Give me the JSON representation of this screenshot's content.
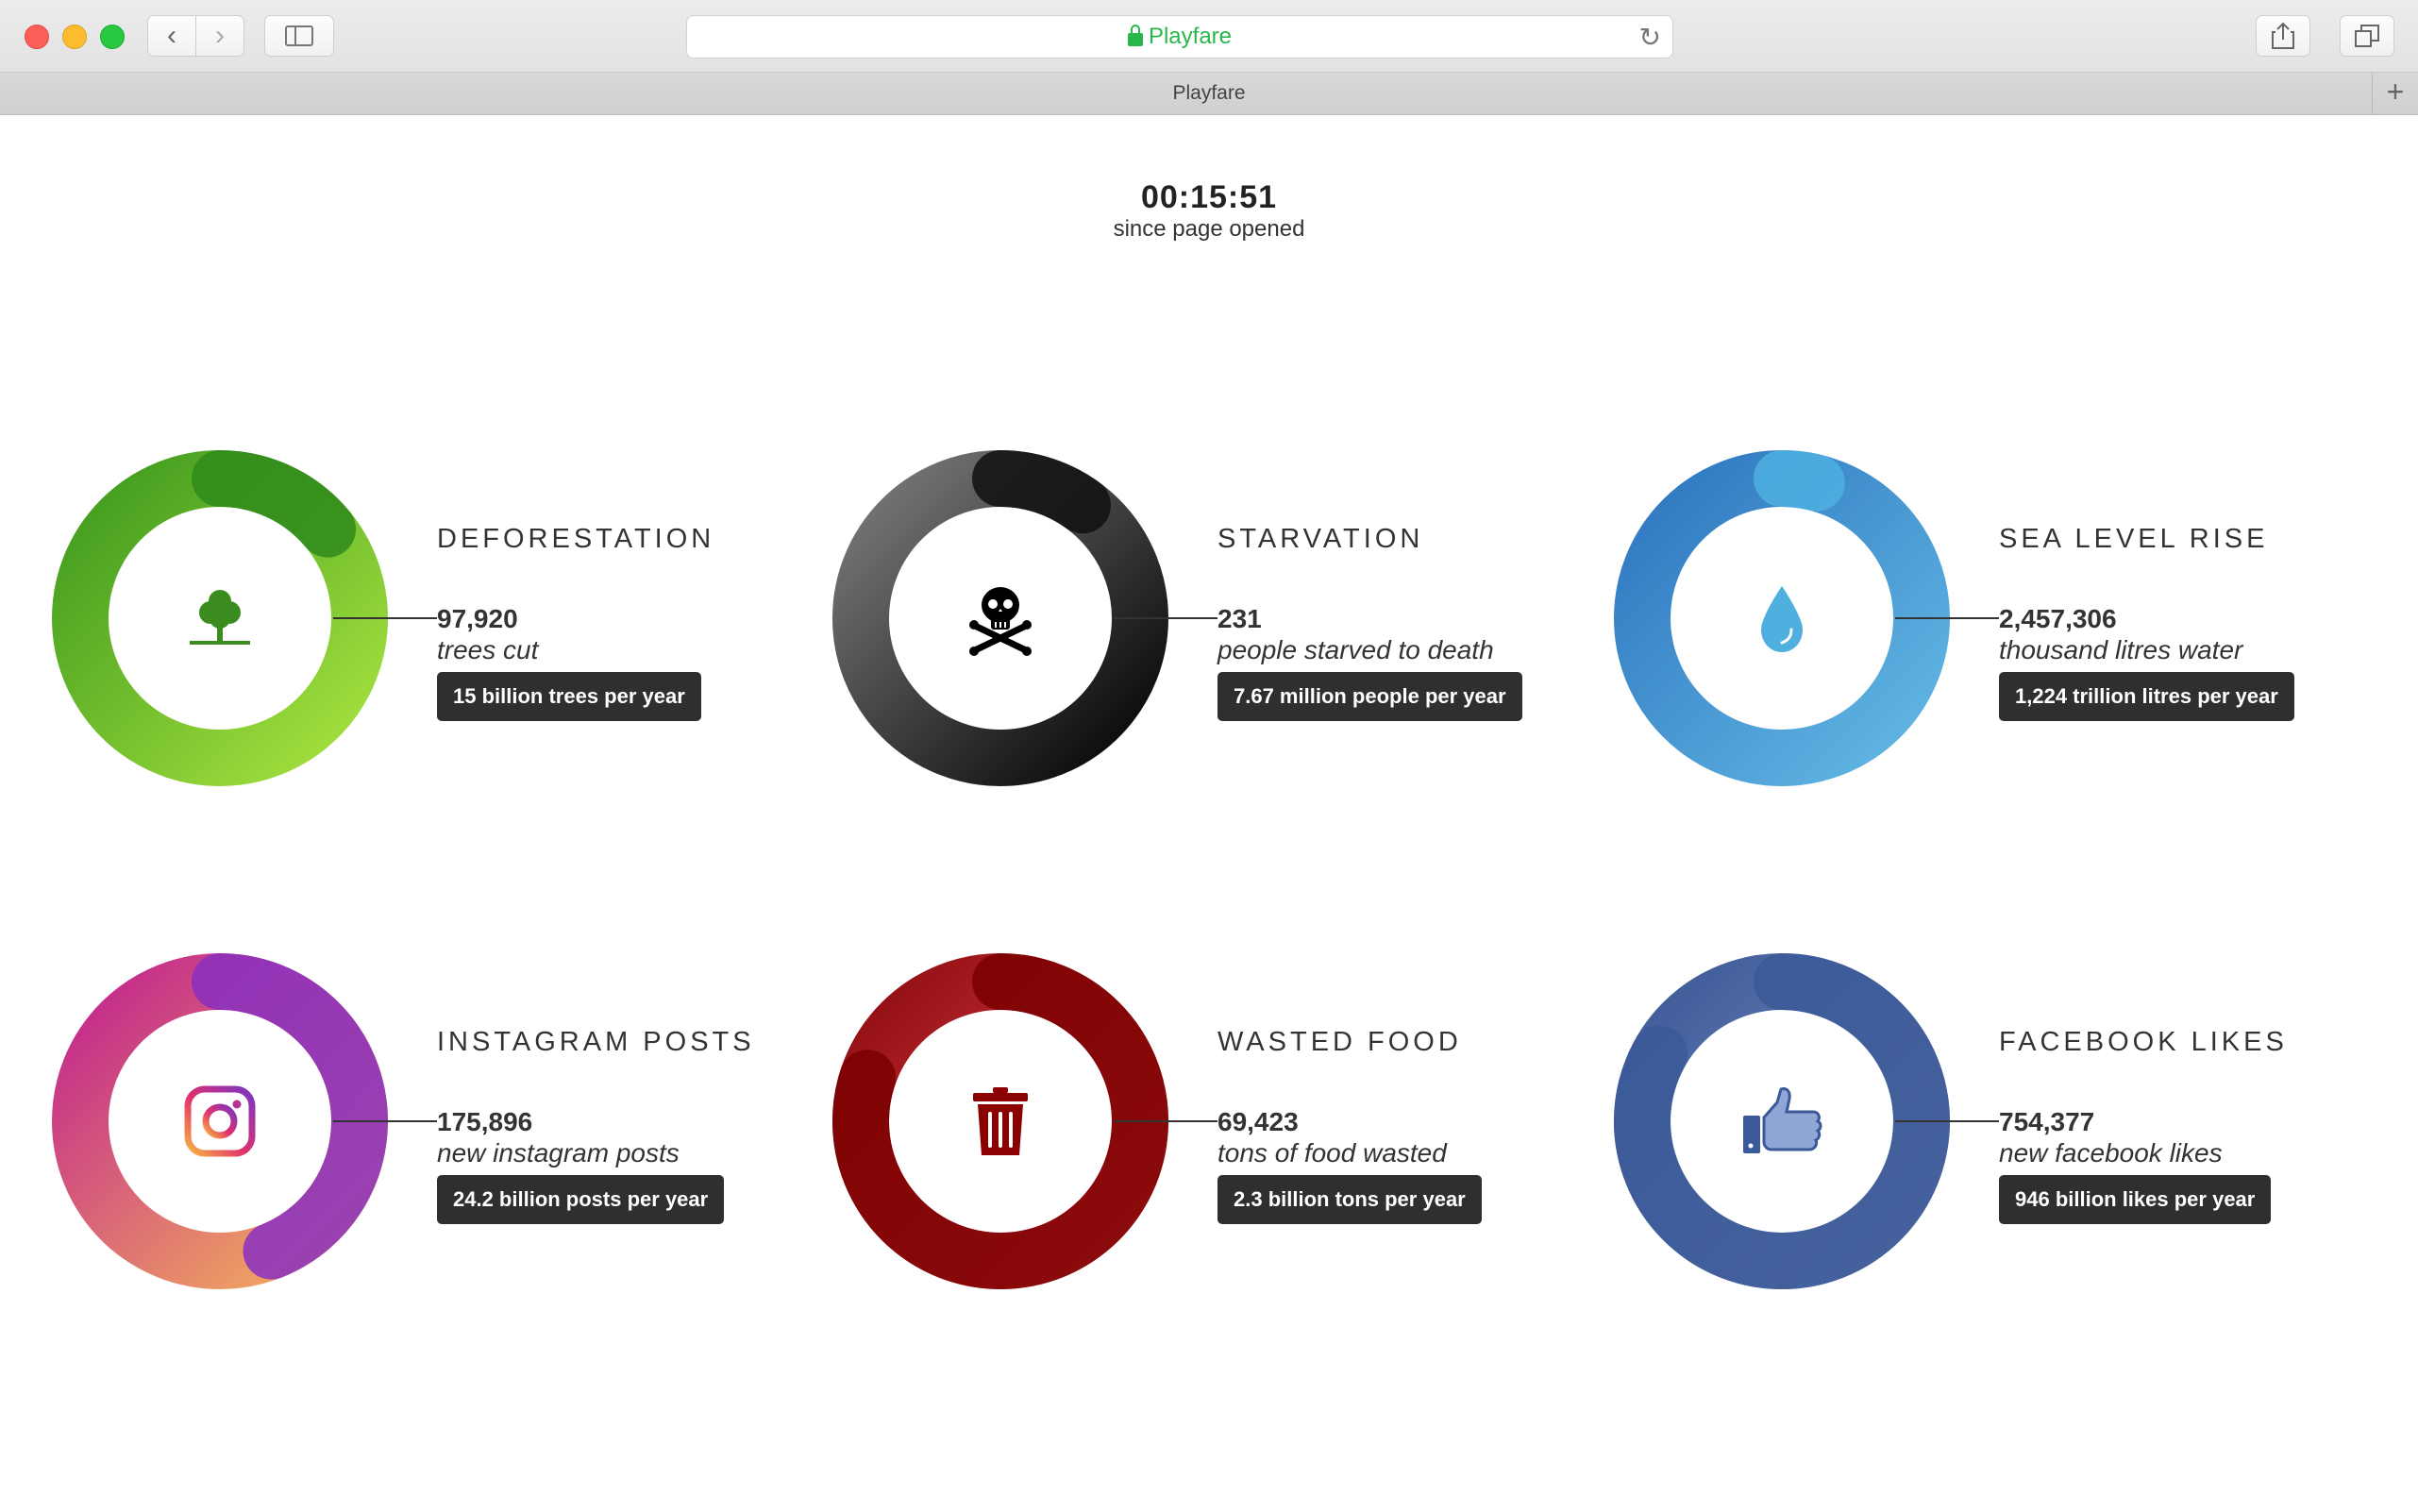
{
  "browser": {
    "url": "Playfare",
    "tab_title": "Playfare",
    "new_tab": "+"
  },
  "timer": {
    "value": "00:15:51",
    "label": "since page opened"
  },
  "cards": [
    {
      "title": "DEFORESTATION",
      "count": "97,920",
      "description": "trees cut",
      "rate": "15 billion trees per year",
      "icon": "tree-icon",
      "colors": {
        "from": "#3f9a1e",
        "to": "#a6e23e",
        "accent": "#2f8a1b"
      },
      "progress": 0.14
    },
    {
      "title": "STARVATION",
      "count": "231",
      "description": "people starved to death",
      "rate": "7.67 million people per year",
      "icon": "skull-crossbones-icon",
      "colors": {
        "from": "#7a7a7a",
        "to": "#050505",
        "accent": "#111111"
      },
      "progress": 0.1
    },
    {
      "title": "SEA LEVEL RISE",
      "count": "2,457,306",
      "description": "thousand litres water",
      "rate": "1,224 trillion litres per year",
      "icon": "water-drop-icon",
      "colors": {
        "from": "#2f76c0",
        "to": "#62b8e4",
        "accent": "#4fb0e0"
      },
      "progress": 0.04
    },
    {
      "title": "INSTAGRAM POSTS",
      "count": "175,896",
      "description": "new instagram posts",
      "rate": "24.2 billion posts per year",
      "icon": "instagram-icon",
      "colors": {
        "from": "#c1258e",
        "to": "#f5b35c",
        "accent": "#8a2fc0"
      },
      "progress": 0.44
    },
    {
      "title": "WASTED FOOD",
      "count": "69,423",
      "description": "tons of food wasted",
      "rate": "2.3 billion tons per year",
      "icon": "trash-can-icon",
      "colors": {
        "from": "#8e0d10",
        "to": "#f04a57",
        "accent": "#7a0000"
      },
      "progress": 0.8
    },
    {
      "title": "FACEBOOK LIKES",
      "count": "754,377",
      "description": "new facebook likes",
      "rate": "946 billion likes per year",
      "icon": "thumbs-up-icon",
      "colors": {
        "from": "#3d5a98",
        "to": "#8194c2",
        "accent": "#3b5998"
      },
      "progress": 0.83
    }
  ]
}
